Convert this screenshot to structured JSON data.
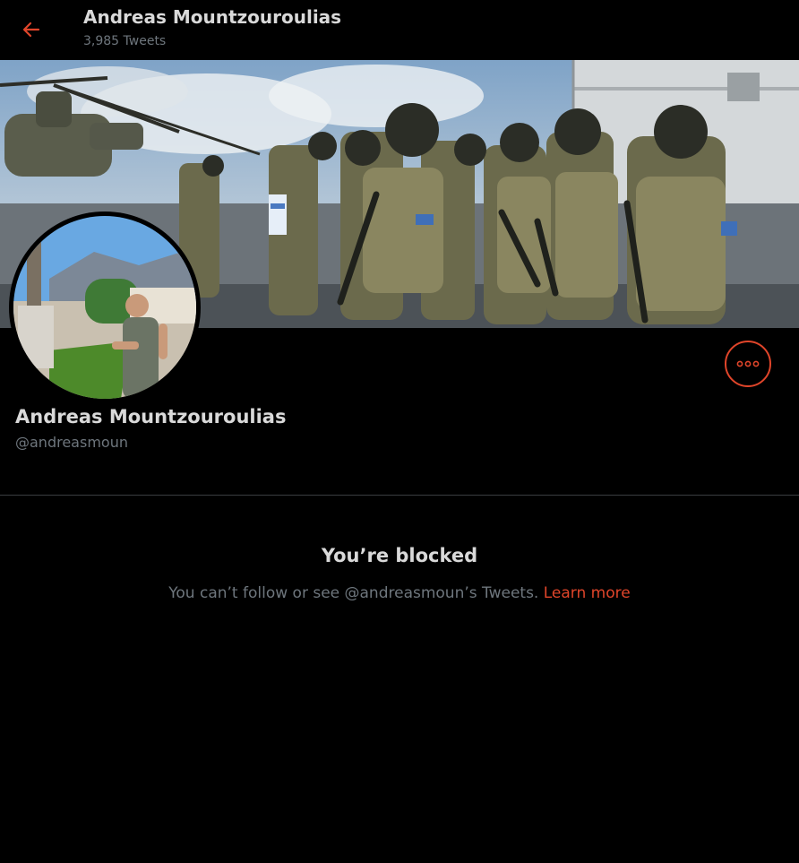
{
  "header": {
    "back_icon": "arrow-left-icon",
    "title": "Andreas Mountzouroulias",
    "subtitle": "3,985 Tweets"
  },
  "profile": {
    "name": "Andreas Mountzouroulias",
    "handle": "@andreasmoun",
    "more_icon": "more-horizontal-icon"
  },
  "blocked": {
    "title": "You’re blocked",
    "message": "You can’t follow or see @andreasmoun’s Tweets.",
    "link": "Learn more"
  },
  "colors": {
    "accent": "#e0452a",
    "background": "#000000",
    "text_primary": "#d9d9d9",
    "text_secondary": "#6e767d",
    "divider": "#3a3d40"
  }
}
